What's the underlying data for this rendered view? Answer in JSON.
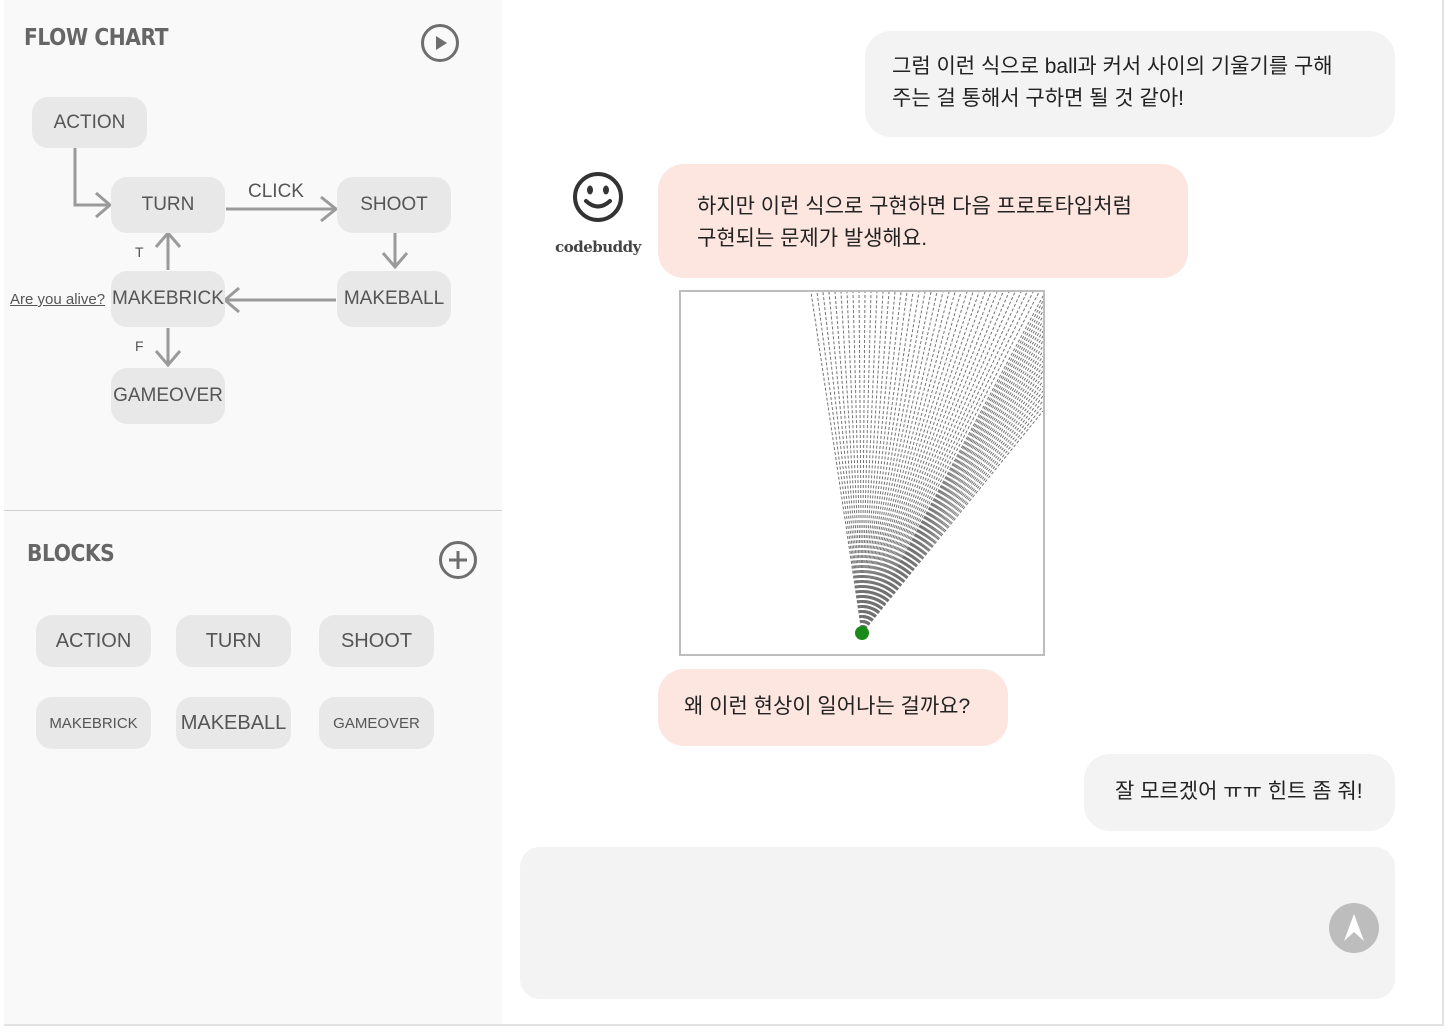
{
  "flowchart": {
    "title": "FLOW CHART",
    "play_icon": "play-circle-icon",
    "nodes": {
      "action": "ACTION",
      "turn": "TURN",
      "shoot": "SHOOT",
      "makebrick": "MAKEBRICK",
      "makeball": "MAKEBALL",
      "gameover": "GAMEOVER"
    },
    "edge_labels": {
      "click": "CLICK",
      "true": "T",
      "false": "F"
    },
    "condition_link": "Are you alive?"
  },
  "blocks": {
    "title": "BLOCKS",
    "add_icon": "plus-circle-icon",
    "items": [
      "ACTION",
      "TURN",
      "SHOOT",
      "MAKEBRICK",
      "MAKEBALL",
      "GAMEOVER"
    ]
  },
  "chat": {
    "bot_name": "codebuddy",
    "bot_avatar_icon": "smiley-face-icon",
    "messages": [
      {
        "role": "user",
        "lines": [
          "그럼 이런 식으로 ball과 커서 사이의 기울기를 구해",
          "주는 걸 통해서 구하면 될 것 같아!"
        ]
      },
      {
        "role": "bot",
        "lines": [
          "하지만 이런 식으로 구현하면 다음 프로토타입처럼",
          "구현되는 문제가 발생해요."
        ]
      },
      {
        "role": "bot",
        "lines": [
          "왜 이런 현상이 일어나는 걸까요?"
        ]
      },
      {
        "role": "user",
        "lines": [
          "잘 모르겠어 ㅠㅠ 힌트 좀 줘!"
        ]
      }
    ],
    "prototype_image": "dotted-trajectory-lines-from-ball",
    "input": {
      "value": "",
      "placeholder": ""
    },
    "send_icon": "send-arrow-icon"
  },
  "colors": {
    "panel_bg": "#f9f9f9",
    "node_bg": "#e8e8e8",
    "user_bubble": "#f3f3f3",
    "bot_bubble": "#fce6df",
    "ball": "#1a8a1a"
  }
}
